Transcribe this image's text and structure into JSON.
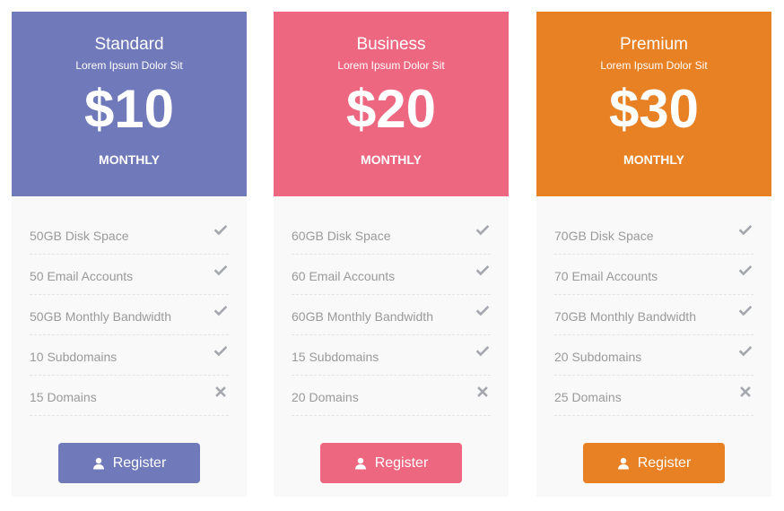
{
  "plans": [
    {
      "name": "Standard",
      "subtitle": "Lorem Ipsum Dolor Sit",
      "price": "$10",
      "period": "MONTHLY",
      "color": "#7079b9",
      "features": [
        {
          "label": "50GB Disk Space",
          "icon": "check-icon"
        },
        {
          "label": "50 Email Accounts",
          "icon": "check-icon"
        },
        {
          "label": "50GB Monthly Bandwidth",
          "icon": "check-icon"
        },
        {
          "label": "10 Subdomains",
          "icon": "check-icon"
        },
        {
          "label": "15 Domains",
          "icon": "close-icon"
        }
      ],
      "button_label": "Register",
      "button_icon": "user-icon"
    },
    {
      "name": "Business",
      "subtitle": "Lorem Ipsum Dolor Sit",
      "price": "$20",
      "period": "MONTHLY",
      "color": "#ed6780",
      "features": [
        {
          "label": "60GB Disk Space",
          "icon": "check-icon"
        },
        {
          "label": "60 Email Accounts",
          "icon": "check-icon"
        },
        {
          "label": "60GB Monthly Bandwidth",
          "icon": "check-icon"
        },
        {
          "label": "15 Subdomains",
          "icon": "check-icon"
        },
        {
          "label": "20 Domains",
          "icon": "close-icon"
        }
      ],
      "button_label": "Register",
      "button_icon": "user-icon"
    },
    {
      "name": "Premium",
      "subtitle": "Lorem Ipsum Dolor Sit",
      "price": "$30",
      "period": "MONTHLY",
      "color": "#e88024",
      "features": [
        {
          "label": "70GB Disk Space",
          "icon": "check-icon"
        },
        {
          "label": "70 Email Accounts",
          "icon": "check-icon"
        },
        {
          "label": "70GB Monthly Bandwidth",
          "icon": "check-icon"
        },
        {
          "label": "20 Subdomains",
          "icon": "check-icon"
        },
        {
          "label": "25 Domains",
          "icon": "close-icon"
        }
      ],
      "button_label": "Register",
      "button_icon": "user-icon"
    }
  ]
}
